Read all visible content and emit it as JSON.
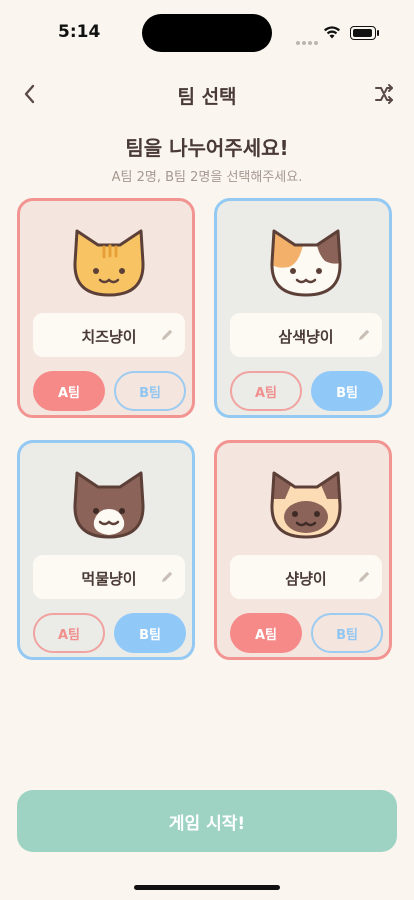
{
  "status_bar": {
    "time": "5:14"
  },
  "nav": {
    "title": "팀 선택",
    "back_icon": "chevron-left-icon",
    "shuffle_icon": "shuffle-icon"
  },
  "header": {
    "headline": "팀을 나누어주세요!",
    "subtitle": "A팀 2명, B팀 2명을 선택해주세요."
  },
  "team_labels": {
    "a": "A팀",
    "b": "B팀"
  },
  "colors": {
    "team_a": "#f58a89",
    "team_b": "#90c8f8",
    "start_button": "#9ed3c4",
    "background": "#faf6ef"
  },
  "cats": [
    {
      "name": "치즈냥이",
      "team": "A",
      "face": "cheese-cat-icon"
    },
    {
      "name": "삼색냥이",
      "team": "B",
      "face": "calico-cat-icon"
    },
    {
      "name": "먹물냥이",
      "team": "B",
      "face": "tuxedo-cat-icon"
    },
    {
      "name": "샴냥이",
      "team": "A",
      "face": "siamese-cat-icon"
    }
  ],
  "start_button": {
    "label": "게임 시작!"
  }
}
